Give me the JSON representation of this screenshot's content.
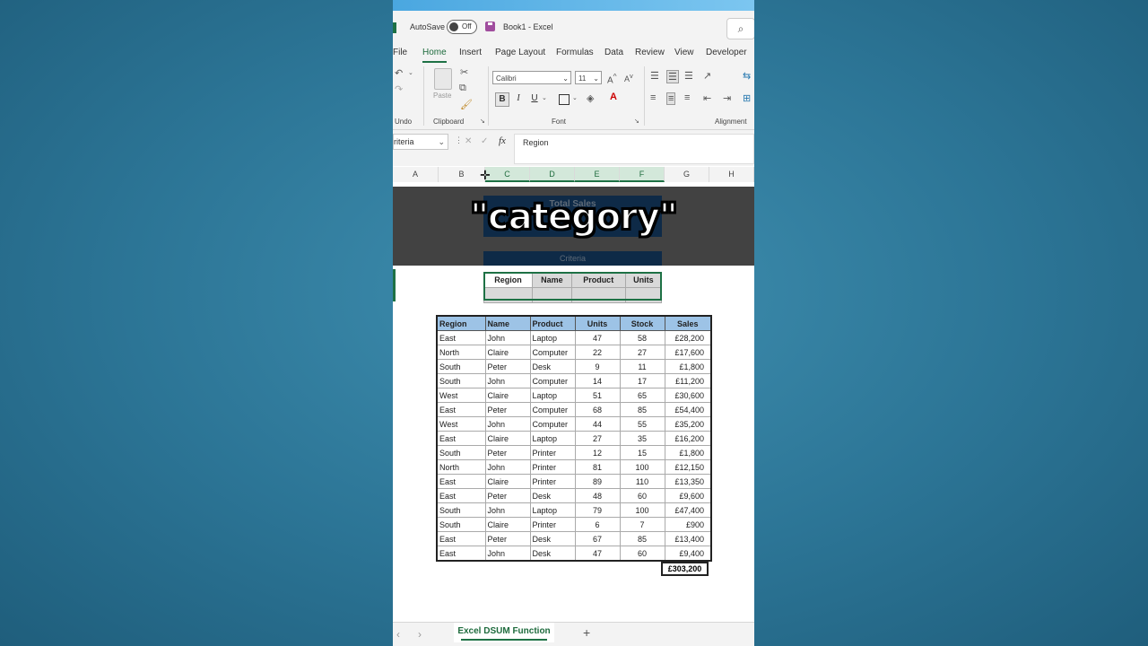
{
  "window": {
    "autosave_label": "AutoSave",
    "autosave_state": "Off",
    "title": "Book1 - Excel"
  },
  "ribbon_tabs": [
    "File",
    "Home",
    "Insert",
    "Page Layout",
    "Formulas",
    "Data",
    "Review",
    "View",
    "Developer"
  ],
  "ribbon": {
    "undo_label": "Undo",
    "paste_label": "Paste",
    "clipboard_label": "Clipboard",
    "font_name": "Calibri",
    "font_size": "11",
    "font_label": "Font",
    "alignment_label": "Alignment",
    "bold": "B",
    "italic": "I",
    "underline": "U"
  },
  "formula_bar": {
    "name_box": "riteria",
    "fx": "fx",
    "value": "Region"
  },
  "columns": [
    "A",
    "B",
    "C",
    "D",
    "E",
    "F",
    "G",
    "H"
  ],
  "caption": "\"category\"",
  "total_sales_label": "Total Sales",
  "criteria_label": "Criteria",
  "criteria_headers": [
    "Region",
    "Name",
    "Product",
    "Units"
  ],
  "table": {
    "headers": [
      "Region",
      "Name",
      "Product",
      "Units",
      "Stock",
      "Sales"
    ],
    "rows": [
      [
        "East",
        "John",
        "Laptop",
        "47",
        "58",
        "£28,200"
      ],
      [
        "North",
        "Claire",
        "Computer",
        "22",
        "27",
        "£17,600"
      ],
      [
        "South",
        "Peter",
        "Desk",
        "9",
        "11",
        "£1,800"
      ],
      [
        "South",
        "John",
        "Computer",
        "14",
        "17",
        "£11,200"
      ],
      [
        "West",
        "Claire",
        "Laptop",
        "51",
        "65",
        "£30,600"
      ],
      [
        "East",
        "Peter",
        "Computer",
        "68",
        "85",
        "£54,400"
      ],
      [
        "West",
        "John",
        "Computer",
        "44",
        "55",
        "£35,200"
      ],
      [
        "East",
        "Claire",
        "Laptop",
        "27",
        "35",
        "£16,200"
      ],
      [
        "South",
        "Peter",
        "Printer",
        "12",
        "15",
        "£1,800"
      ],
      [
        "North",
        "John",
        "Printer",
        "81",
        "100",
        "£12,150"
      ],
      [
        "East",
        "Claire",
        "Printer",
        "89",
        "110",
        "£13,350"
      ],
      [
        "East",
        "Peter",
        "Desk",
        "48",
        "60",
        "£9,600"
      ],
      [
        "South",
        "John",
        "Laptop",
        "79",
        "100",
        "£47,400"
      ],
      [
        "South",
        "Claire",
        "Printer",
        "6",
        "7",
        "£900"
      ],
      [
        "East",
        "Peter",
        "Desk",
        "67",
        "85",
        "£13,400"
      ],
      [
        "East",
        "John",
        "Desk",
        "47",
        "60",
        "£9,400"
      ]
    ],
    "total": "£303,200"
  },
  "sheet_tab": "Excel DSUM Function",
  "colors": {
    "background": "#2c7596",
    "excel_green": "#1e7145",
    "header_blue": "#9dc3e6",
    "dark_navy": "#0e2a47"
  }
}
